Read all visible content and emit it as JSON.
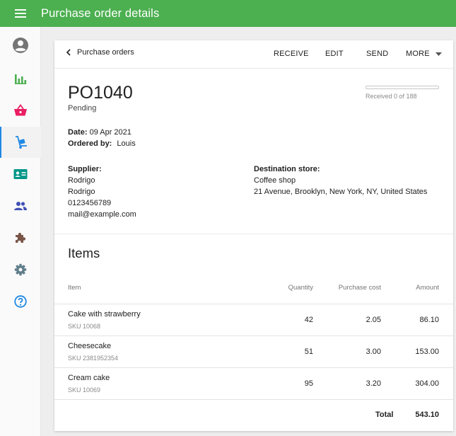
{
  "header": {
    "title": "Purchase order details",
    "menu_icon": "menu-icon"
  },
  "sidebar": {
    "items": [
      {
        "name": "account",
        "icon": "account-circle-icon",
        "color": "#757575"
      },
      {
        "name": "reports",
        "icon": "bar-chart-icon",
        "color": "#4caf50"
      },
      {
        "name": "sales",
        "icon": "basket-icon",
        "color": "#e91e63"
      },
      {
        "name": "inventory",
        "icon": "dolly-icon",
        "color": "#1e88e5",
        "active": true
      },
      {
        "name": "customers",
        "icon": "id-card-icon",
        "color": "#009688"
      },
      {
        "name": "employees",
        "icon": "people-icon",
        "color": "#3f51b5"
      },
      {
        "name": "integrations",
        "icon": "puzzle-icon",
        "color": "#795548"
      },
      {
        "name": "settings",
        "icon": "gear-icon",
        "color": "#607d8b"
      },
      {
        "name": "help",
        "icon": "help-circle-icon",
        "color": "#1e88e5"
      }
    ]
  },
  "toolbar": {
    "back_label": "Purchase orders",
    "receive": "RECEIVE",
    "edit": "EDIT",
    "send": "SEND",
    "more": "MORE"
  },
  "order": {
    "number": "PO1040",
    "status": "Pending",
    "received": 0,
    "total_qty": 188,
    "received_text": "Received 0 of 188",
    "date_label": "Date:",
    "date": "09 Apr 2021",
    "ordered_by_label": "Ordered by:",
    "ordered_by": "Louis"
  },
  "supplier": {
    "label": "Supplier:",
    "name": "Rodrigo",
    "contact": "Rodrigo",
    "phone": "0123456789",
    "email": "mail@example.com"
  },
  "destination": {
    "label": "Destination store:",
    "store": "Coffee shop",
    "address": "21 Avenue, Brooklyn, New York, NY, United States"
  },
  "items": {
    "title": "Items",
    "columns": {
      "item": "Item",
      "quantity": "Quantity",
      "cost": "Purchase cost",
      "amount": "Amount"
    },
    "rows": [
      {
        "name": "Cake with strawberry",
        "sku": "SKU 10068",
        "quantity": "42",
        "cost": "2.05",
        "amount": "86.10"
      },
      {
        "name": "Cheesecake",
        "sku": "SKU 2381952354",
        "quantity": "51",
        "cost": "3.00",
        "amount": "153.00"
      },
      {
        "name": "Cream cake",
        "sku": "SKU 10069",
        "quantity": "95",
        "cost": "3.20",
        "amount": "304.00"
      }
    ],
    "total_label": "Total",
    "total": "543.10"
  },
  "colors": {
    "appbar": "#4caf50",
    "accent": "#1e88e5"
  }
}
